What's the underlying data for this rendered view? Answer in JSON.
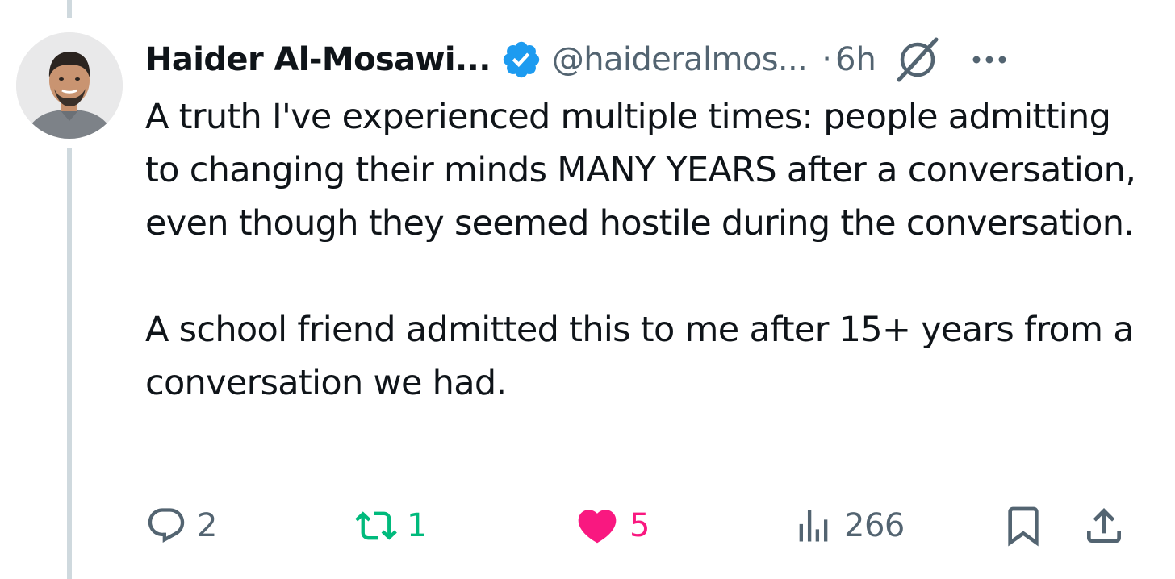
{
  "author": {
    "name": "Haider Al-Mosawi...",
    "handle": "@haideralmos...",
    "verified": true,
    "time": "6h",
    "separator": "·"
  },
  "tweet": {
    "paragraphs": [
      "A truth I've experienced multiple times: people admitting to changing their minds MANY YEARS after a conversation, even though they seemed hostile during the conversation.",
      "A school friend admitted this to me after 15+ years from a conversation we had."
    ]
  },
  "actions": {
    "replies": "2",
    "reposts": "1",
    "likes": "5",
    "views": "266"
  },
  "icons": {
    "verified": "verified-badge-icon",
    "grok": "grok-icon",
    "more": "more-icon",
    "reply": "reply-icon",
    "repost": "repost-icon",
    "like": "heart-icon",
    "views": "views-icon",
    "bookmark": "bookmark-icon",
    "share": "share-icon"
  },
  "colors": {
    "text": "#0f1419",
    "secondary": "#536471",
    "verified": "#1d9bf0",
    "repost": "#00ba7c",
    "like": "#f91880",
    "thread_line": "#cfd9de"
  }
}
